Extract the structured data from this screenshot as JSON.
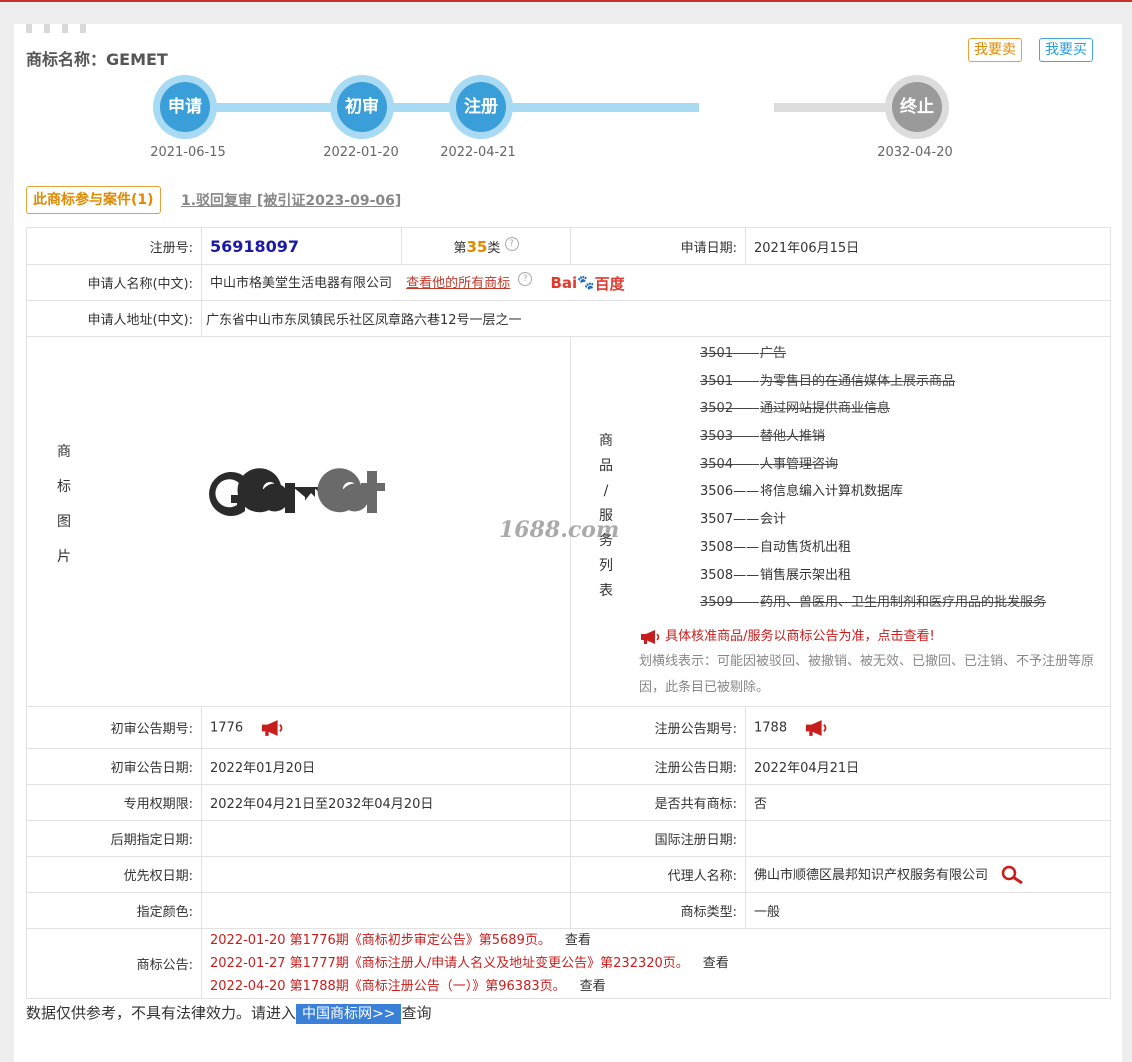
{
  "header": {
    "title": "商标名称：GEMET",
    "sell_btn": "我要卖",
    "buy_btn": "我要买"
  },
  "timeline": [
    {
      "label": "申请",
      "date": "2021-06-15"
    },
    {
      "label": "初审",
      "date": "2022-01-20"
    },
    {
      "label": "注册",
      "date": "2022-04-21"
    },
    {
      "label": "终止",
      "date": "2032-04-20"
    }
  ],
  "cases": {
    "tag": "此商标参与案件(1)",
    "link": "1.驳回复审 [被引证2023-09-06]"
  },
  "info": {
    "reg_no_label": "注册号:",
    "reg_no": "56918097",
    "class_prefix": "第",
    "class_num": "35",
    "class_suffix": "类",
    "apply_date_label": "申请日期:",
    "apply_date": "2021年06月15日",
    "applicant_label": "申请人名称(中文):",
    "applicant": "中山市格美堂生活电器有限公司",
    "applicant_link": "查看他的所有商标",
    "baidu_text1": "Bai",
    "baidu_text2": "百度",
    "address_label": "申请人地址(中文):",
    "address": "广东省中山市东凤镇民乐社区凤章路六巷12号一层之一",
    "image_label": [
      "商",
      "标",
      "图",
      "片"
    ],
    "logo_text": "GEMET",
    "goods_label": [
      "商",
      "品",
      "/",
      "服",
      "务",
      "列",
      "表"
    ],
    "watermark": "1688.com"
  },
  "goods": [
    {
      "code": "3501",
      "name": "广告",
      "strike": true
    },
    {
      "code": "3501",
      "name": "为零售目的在通信媒体上展示商品",
      "strike": true
    },
    {
      "code": "3502",
      "name": "通过网站提供商业信息",
      "strike": true
    },
    {
      "code": "3503",
      "name": "替他人推销",
      "strike": true
    },
    {
      "code": "3504",
      "name": "人事管理咨询",
      "strike": true
    },
    {
      "code": "3506",
      "name": "将信息编入计算机数据库",
      "strike": false
    },
    {
      "code": "3507",
      "name": "会计",
      "strike": false
    },
    {
      "code": "3508",
      "name": "自动售货机出租",
      "strike": false
    },
    {
      "code": "3508",
      "name": "销售展示架出租",
      "strike": false
    },
    {
      "code": "3509",
      "name": "药用、兽医用、卫生用制剂和医疗用品的批发服务",
      "strike": true
    }
  ],
  "goods_dash": "——",
  "goods_note": "具体核准商品/服务以商标公告为准，点击查看!",
  "goods_strike_note": "划横线表示：可能因被驳回、被撤销、被无效、已撤回、已注销、不予注册等原因，此条目已被剔除。",
  "details": {
    "prelim_no_label": "初审公告期号:",
    "prelim_no": "1776",
    "reg_ann_no_label": "注册公告期号:",
    "reg_ann_no": "1788",
    "prelim_date_label": "初审公告日期:",
    "prelim_date": "2022年01月20日",
    "reg_ann_date_label": "注册公告日期:",
    "reg_ann_date": "2022年04月21日",
    "exclusive_label": "专用权期限:",
    "exclusive": "2022年04月21日至2032年04月20日",
    "shared_label": "是否共有商标:",
    "shared": "否",
    "later_label": "后期指定日期:",
    "later": "",
    "intl_label": "国际注册日期:",
    "intl": "",
    "priority_label": "优先权日期:",
    "priority": "",
    "agent_label": "代理人名称:",
    "agent": "佛山市顺德区晨邦知识产权服务有限公司",
    "color_label": "指定颜色:",
    "color": "",
    "type_label": "商标类型:",
    "type": "一般",
    "ann_label": "商标公告:"
  },
  "announcements": [
    {
      "text": "2022-01-20 第1776期《商标初步审定公告》第5689页。",
      "view": "查看"
    },
    {
      "text": "2022-01-27 第1777期《商标注册人/申请人名义及地址变更公告》第232320页。",
      "view": "查看"
    },
    {
      "text": "2022-04-20 第1788期《商标注册公告（一）》第96383页。",
      "view": "查看"
    }
  ],
  "footer": {
    "text": "数据仅供参考，不具有法律效力。请进入",
    "button": "中国商标网>>",
    "after": "查询"
  },
  "colors": {
    "accent_blue": "#3a9fd8",
    "accent_orange": "#e08a00",
    "red": "#c81d1d"
  }
}
